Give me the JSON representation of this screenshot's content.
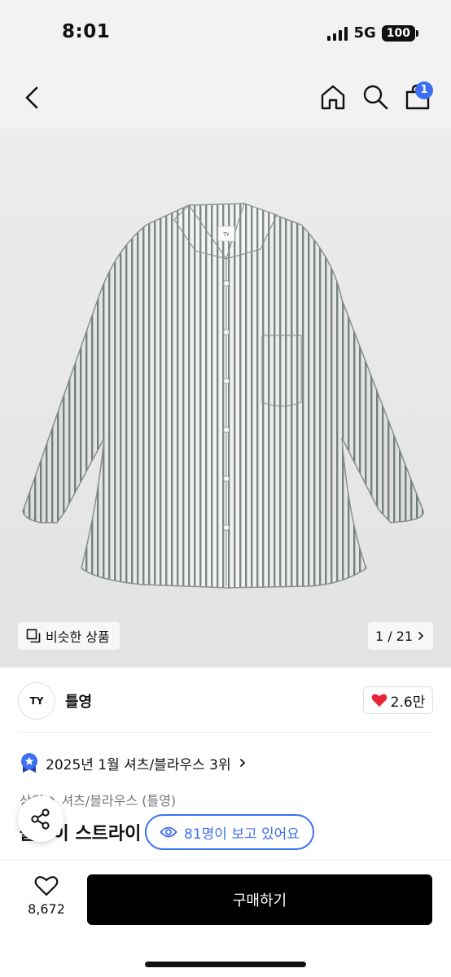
{
  "status_bar": {
    "time": "8:01",
    "network": "5G",
    "battery": "100"
  },
  "nav": {
    "cart_count": "1",
    "icons": [
      "back-arrow-icon",
      "home-icon",
      "search-icon",
      "cart-icon"
    ]
  },
  "gallery": {
    "similar_label": "비슷한 상품",
    "counter": "1 / 21",
    "logo_tag": "TY"
  },
  "brand": {
    "logo": "TY",
    "name": "틀영",
    "likes": "2.6만",
    "like_color": "#e8263a"
  },
  "product": {
    "rank": "2025년 1월 셔츠/블라우스 3위",
    "category": "상의",
    "subcategory": "셔츠/블라우스 (틀영)",
    "title": "블루이 스트라이"
  },
  "viewers": {
    "label": "81명이 보고 있어요",
    "accent": "#3d6ff2"
  },
  "bottom": {
    "wish_count": "8,672",
    "buy_label": "구매하기"
  }
}
